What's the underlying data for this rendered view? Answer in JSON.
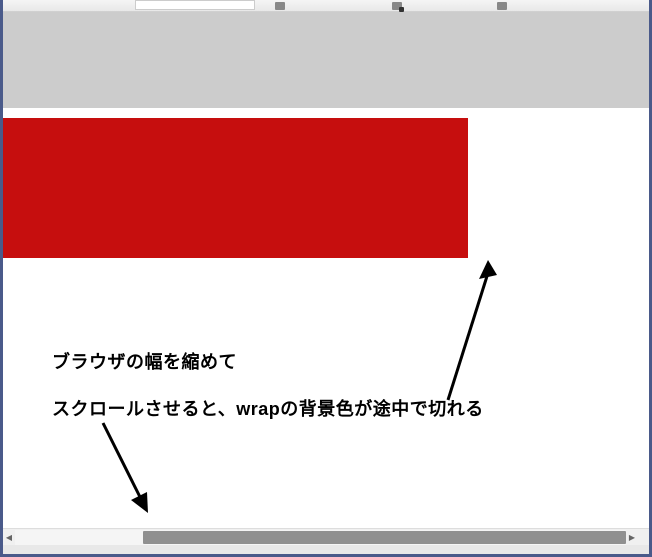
{
  "toolbar": {
    "input_value": ""
  },
  "annotations": {
    "line1": "ブラウザの幅を縮めて",
    "line2": "スクロールさせると、wrapの背景色が途中で切れる"
  },
  "colors": {
    "red_block": "#c60e0e",
    "gray_band": "#cccccc",
    "frame": "#4a5a8a"
  }
}
